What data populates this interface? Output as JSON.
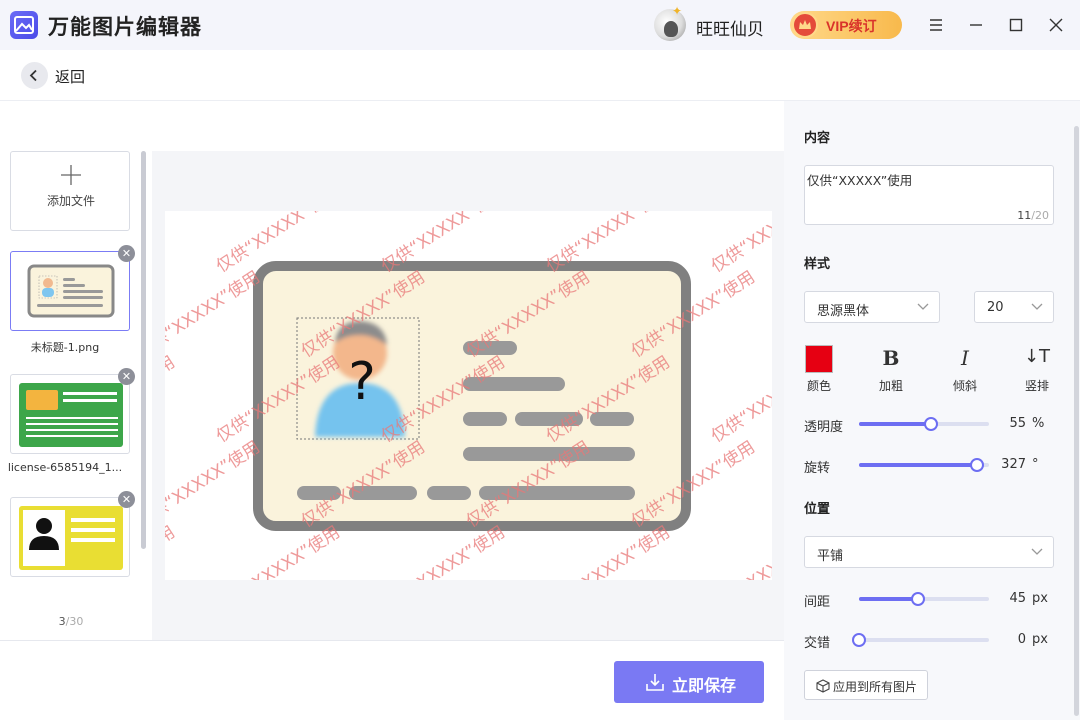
{
  "app": {
    "title": "万能图片编辑器",
    "username": "旺旺仙贝",
    "vip_label": "VIP续订"
  },
  "nav": {
    "back_label": "返回"
  },
  "files": {
    "add_label": "添加文件",
    "items": [
      {
        "name": "未标题-1.png",
        "active": true
      },
      {
        "name": "license-6585194_1...",
        "active": false
      },
      {
        "name": "",
        "active": false
      }
    ],
    "count": "3",
    "max": "/30"
  },
  "canvas": {
    "watermark_text": "仅供“XXXXX”使用"
  },
  "toolbar": {
    "save_label": "立即保存"
  },
  "settings": {
    "content_title": "内容",
    "content_value": "仅供“XXXXX”使用",
    "content_count": "11",
    "content_max": "/20",
    "style_title": "样式",
    "font_family": "思源黑体",
    "font_size": "20",
    "tools": [
      {
        "glyph": "",
        "label": "颜色",
        "icon": "color-swatch"
      },
      {
        "glyph": "B",
        "label": "加粗",
        "icon": "bold-icon"
      },
      {
        "glyph": "I",
        "label": "倾斜",
        "icon": "italic-icon"
      },
      {
        "glyph": "↓T",
        "label": "竖排",
        "icon": "vertical-text-icon"
      }
    ],
    "color": "#e60012",
    "opacity": {
      "label": "透明度",
      "value": "55",
      "unit": "%",
      "fraction": 0.55
    },
    "rotation": {
      "label": "旋转",
      "value": "327",
      "unit": "°",
      "fraction": 0.908
    },
    "position_title": "位置",
    "layout_mode": "平铺",
    "spacing": {
      "label": "间距",
      "value": "45",
      "unit": "px",
      "fraction": 0.45
    },
    "stagger": {
      "label": "交错",
      "value": "0",
      "unit": "px",
      "fraction": 0.0
    },
    "apply_label": "应用到所有图片"
  },
  "colors": {
    "accent": "#7a79f3",
    "slider": "#6d6ef2",
    "watermark": "#e87878"
  }
}
